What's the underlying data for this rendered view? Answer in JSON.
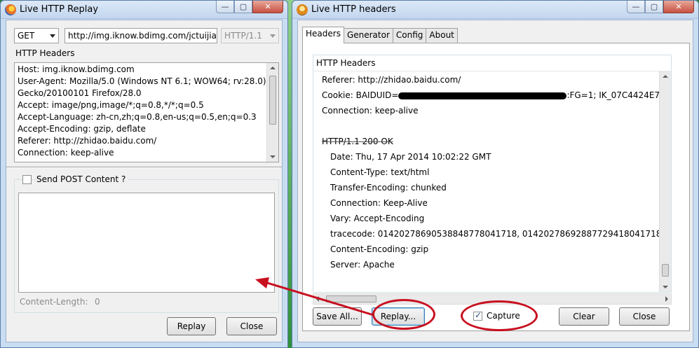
{
  "replay_window": {
    "title": "Live HTTP Replay",
    "method": "GET",
    "url": "http://img.iknow.bdimg.com/jctuijia",
    "protocol": "HTTP/1.1",
    "headers_label": "HTTP Headers",
    "headers_lines": [
      "Host: img.iknow.bdimg.com",
      "User-Agent: Mozilla/5.0 (Windows NT 6.1; WOW64; rv:28.0)",
      "Gecko/20100101 Firefox/28.0",
      "Accept: image/png,image/*;q=0.8,*/*;q=0.5",
      "Accept-Language: zh-cn,zh;q=0.8,en-us;q=0.5,en;q=0.3",
      "Accept-Encoding: gzip, deflate",
      "Referer: http://zhidao.baidu.com/",
      "Connection: keep-alive"
    ],
    "send_post_label": "Send POST Content ?",
    "content_length_label": "Content-Length:",
    "content_length_value": "0",
    "replay_button": "Replay",
    "close_button": "Close"
  },
  "headers_window": {
    "title": "Live HTTP headers",
    "tabs": [
      "Headers",
      "Generator",
      "Config",
      "About"
    ],
    "group_label": "HTTP Headers",
    "referer": "Referer: http://zhidao.baidu.com/",
    "cookie_prefix": "Cookie: BAIDUID=",
    "cookie_suffix": ":FG=1; IK_07C4424E7...",
    "connection_req": "Connection: keep-alive",
    "status_line": "HTTP/1.1 200 OK",
    "response_lines": [
      "Date: Thu, 17 Apr 2014 10:02:22 GMT",
      "Content-Type: text/html",
      "Transfer-Encoding: chunked",
      "Connection: Keep-Alive",
      "Vary: Accept-Encoding",
      "tracecode: 01420278690538848778041718, 01420278692887729418041718",
      "Content-Encoding: gzip",
      "Server: Apache"
    ],
    "save_all_button": "Save All...",
    "replay_button": "Replay...",
    "capture_label": "Capture",
    "capture_checked": true,
    "clear_button": "Clear",
    "close_button": "Close"
  },
  "window_controls": {
    "minimize": "—",
    "maximize": "▢",
    "close": "✕"
  },
  "colors": {
    "annotation_red": "#c8101f",
    "accent": "#3c7fb1"
  }
}
